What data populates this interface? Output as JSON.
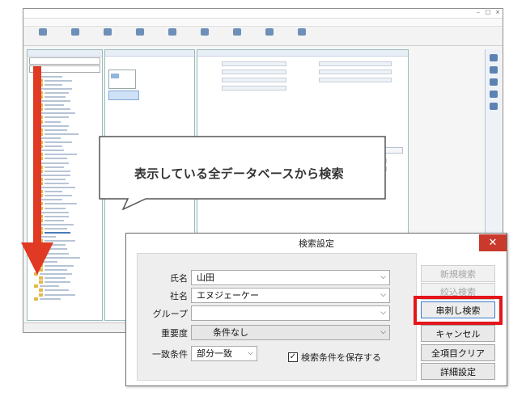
{
  "callout": {
    "text": "表示している全データベースから検索"
  },
  "dialog": {
    "title": "検索設定",
    "fields": {
      "name": {
        "label": "氏名",
        "value": "山田"
      },
      "company": {
        "label": "社名",
        "value": "エヌジェーケー"
      },
      "group": {
        "label": "グループ",
        "value": ""
      },
      "importance": {
        "label": "重要度",
        "value": "条件なし"
      },
      "match": {
        "label": "一致条件",
        "value": "部分一致"
      }
    },
    "save_condition": {
      "label": "検索条件を保存する",
      "checked": true
    },
    "buttons": {
      "new_search": "新規検索",
      "narrow_search": "絞込検索",
      "skewer_search": "串刺し検索",
      "cancel": "キャンセル",
      "clear_all": "全項目クリア",
      "detail_settings": "詳細設定"
    }
  },
  "colors": {
    "highlight": "#e3161b",
    "arrow": "#e03a24",
    "close_button": "#c93a2c"
  }
}
